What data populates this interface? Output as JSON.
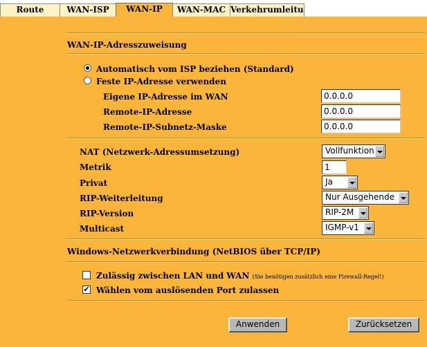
{
  "tabs": [
    {
      "label": "Route"
    },
    {
      "label": "WAN-ISP"
    },
    {
      "label": "WAN-IP",
      "active": true
    },
    {
      "label": "WAN-MAC"
    },
    {
      "label": "Verkehrumleitung"
    }
  ],
  "section_wan_ip": {
    "title": "WAN-IP-Adresszuweisung",
    "radio_auto_label": "Automatisch vom ISP beziehen (Standard)",
    "radio_auto_checked": true,
    "radio_fixed_label": "Feste IP-Adresse verwenden",
    "radio_fixed_checked": false,
    "fields": [
      {
        "label": "Eigene IP-Adresse im WAN",
        "value": "0.0.0.0"
      },
      {
        "label": "Remote-IP-Adresse",
        "value": "0.0.0.0"
      },
      {
        "label": "Remote-IP-Subnetz-Maske",
        "value": "0.0.0.0"
      }
    ]
  },
  "settings": {
    "nat_label": "NAT (Netzwerk-Adressumsetzung)",
    "nat_value": "Vollfunktion",
    "metric_label": "Metrik",
    "metric_value": "1",
    "private_label": "Privat",
    "private_value": "Ja",
    "rip_fwd_label": "RIP-Weiterleitung",
    "rip_fwd_value": "Nur Ausgehende",
    "rip_ver_label": "RIP-Version",
    "rip_ver_value": "RIP-2M",
    "multicast_label": "Multicast",
    "multicast_value": "IGMP-v1"
  },
  "netbios": {
    "title": "Windows-Netzwerkverbindung (NetBIOS über TCP/IP)",
    "allow_lan_wan_label": "Zulässig zwischen LAN und WAN",
    "allow_lan_wan_note": "(Sie benötigen zusätzlich eine Firewall-Regel!)",
    "allow_lan_wan_checked": false,
    "trigger_port_label": "Wählen vom auslösenden Port zulassen",
    "trigger_port_checked": true,
    "check_mark": "✔"
  },
  "buttons": {
    "apply": "Anwenden",
    "reset": "Zurücksetzen"
  }
}
